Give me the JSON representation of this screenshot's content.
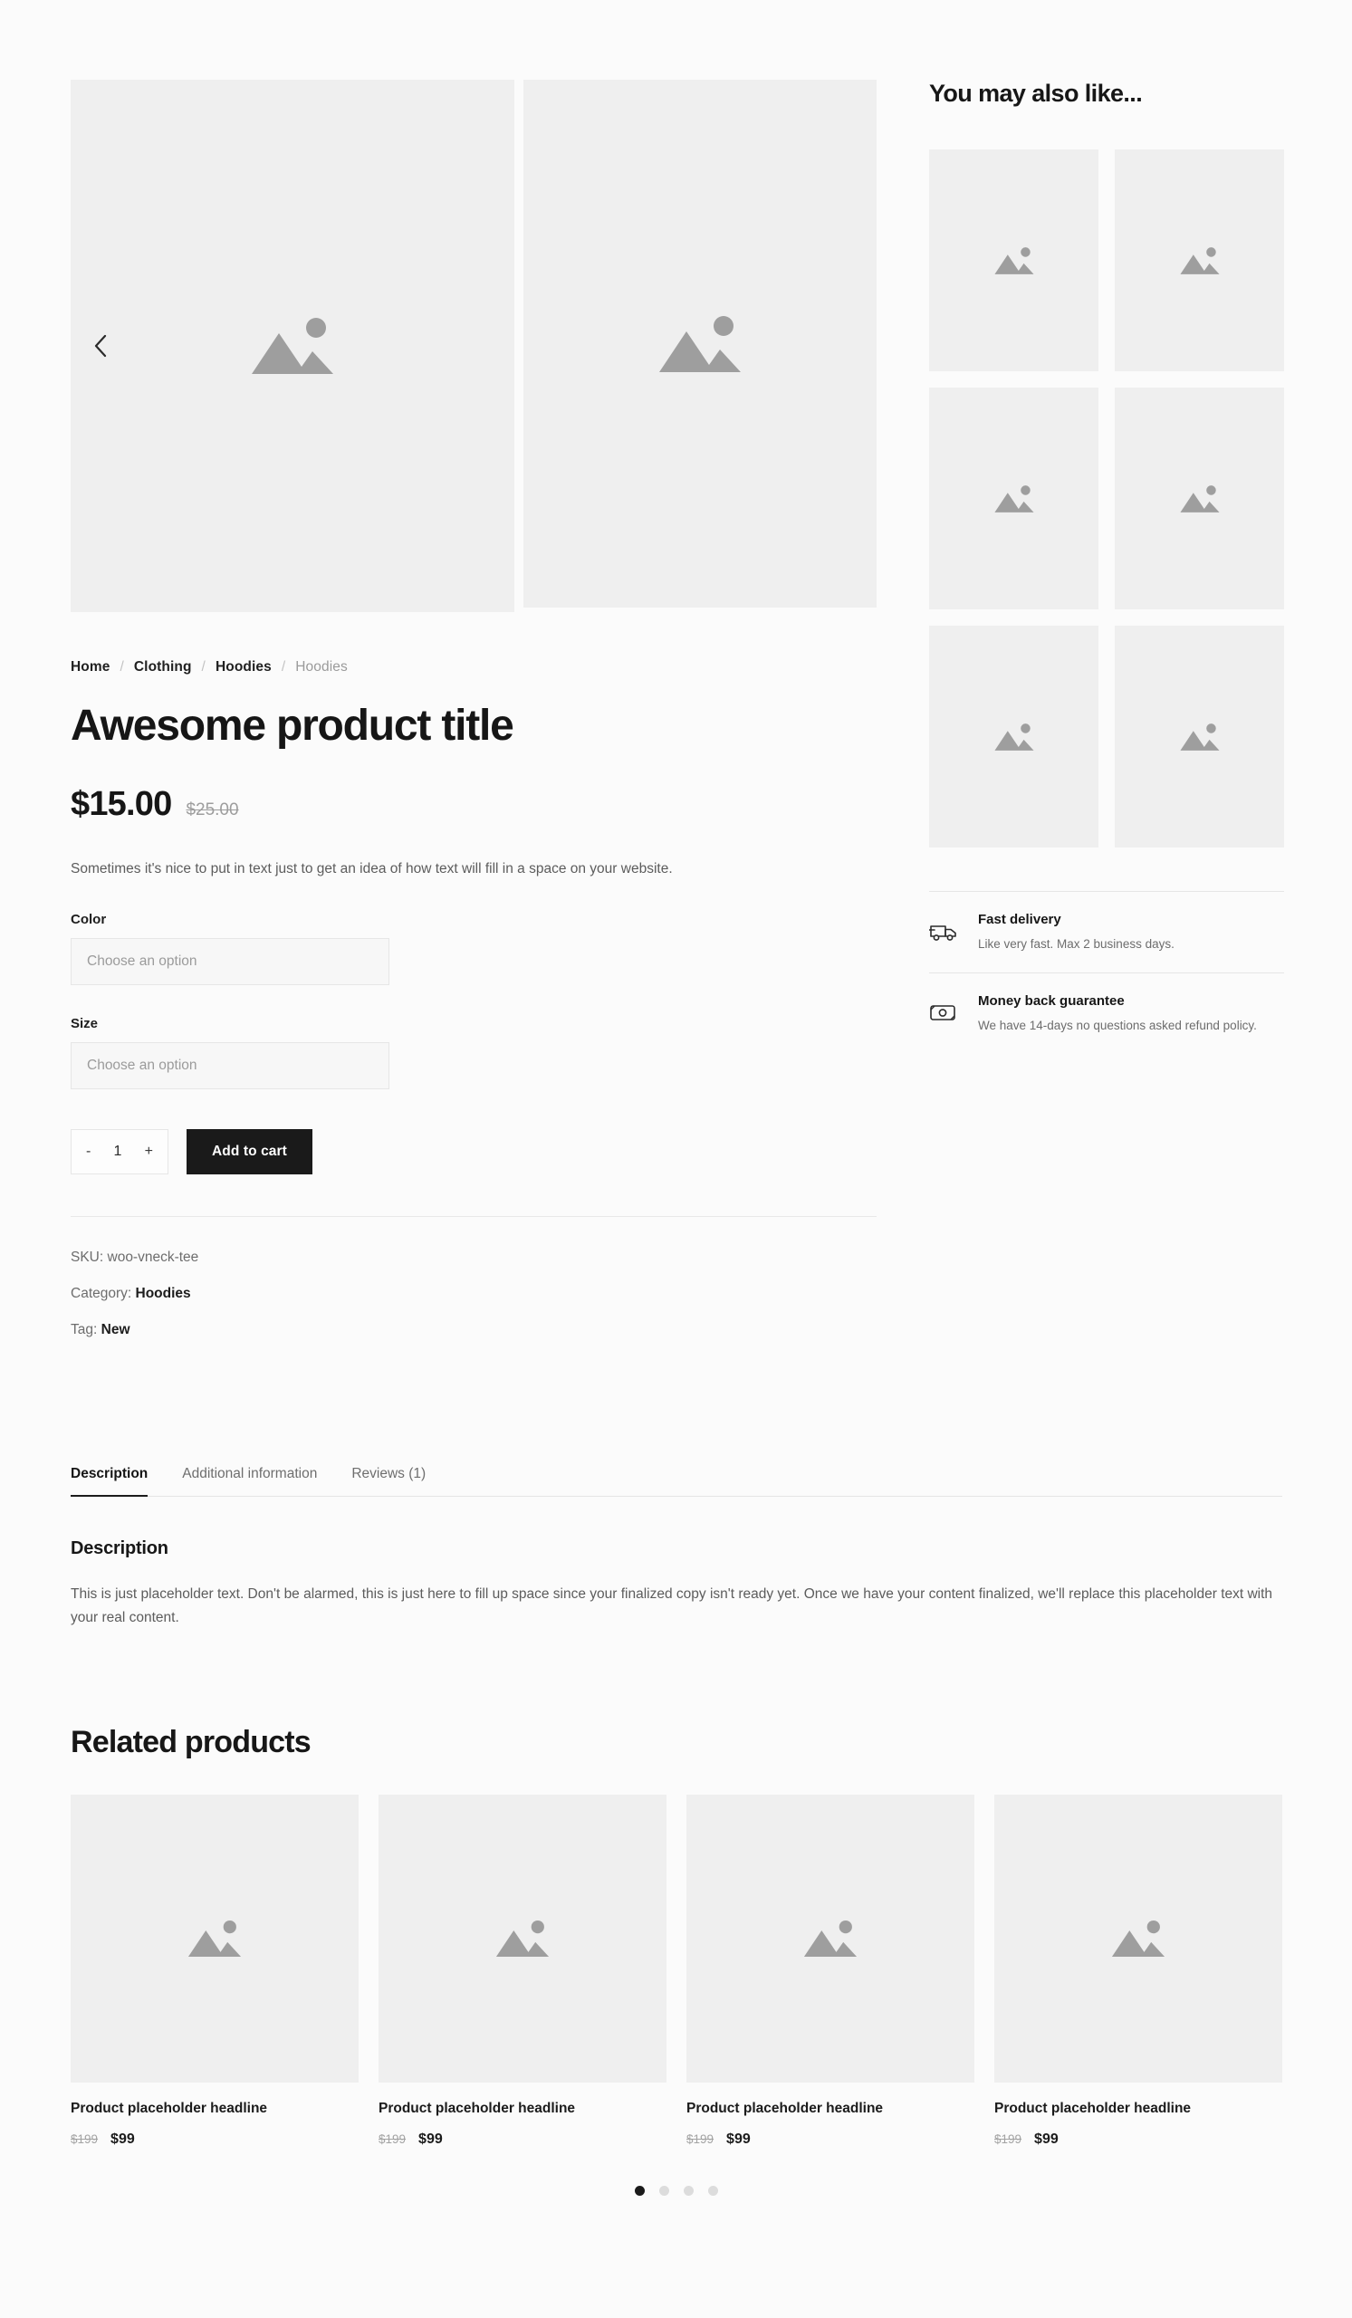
{
  "gallery": {
    "prev_label": "‹",
    "image_alt": "image-placeholder"
  },
  "breadcrumb": {
    "items": [
      {
        "label": "Home",
        "current": false
      },
      {
        "label": "Clothing",
        "current": false
      },
      {
        "label": "Hoodies",
        "current": false
      },
      {
        "label": "Hoodies",
        "current": true
      }
    ],
    "separator": "/"
  },
  "product": {
    "title": "Awesome product title",
    "price_current": "$15.00",
    "price_original": "$25.00",
    "short_description": "Sometimes it's nice to put in text just to get an idea of how text will fill in a space on your website.",
    "options": [
      {
        "label": "Color",
        "placeholder": "Choose an option",
        "value": ""
      },
      {
        "label": "Size",
        "placeholder": "Choose an option",
        "value": ""
      }
    ],
    "quantity": {
      "decrement": "-",
      "value": "1",
      "increment": "+"
    },
    "add_to_cart_label": "Add to cart",
    "meta": {
      "sku_label": "SKU:",
      "sku_value": "woo-vneck-tee",
      "category_label": "Category:",
      "category_value": "Hoodies",
      "tag_label": "Tag:",
      "tag_value": "New"
    }
  },
  "tabs": {
    "items": [
      {
        "label": "Description",
        "active": true
      },
      {
        "label": "Additional information",
        "active": false
      },
      {
        "label": "Reviews (1)",
        "active": false
      }
    ],
    "panel": {
      "heading": "Description",
      "body": "This is just placeholder text. Don't be alarmed, this is just here to fill up space since your finalized copy isn't ready yet. Once we have your content finalized, we'll replace this placeholder text with your real content."
    }
  },
  "related": {
    "heading": "Related products",
    "products": [
      {
        "name": "Product placeholder headline",
        "price_original": "$199",
        "price_current": "$99"
      },
      {
        "name": "Product placeholder headline",
        "price_original": "$199",
        "price_current": "$99"
      },
      {
        "name": "Product placeholder headline",
        "price_original": "$199",
        "price_current": "$99"
      },
      {
        "name": "Product placeholder headline",
        "price_original": "$199",
        "price_current": "$99"
      }
    ],
    "carousel_dots": [
      {
        "active": true
      },
      {
        "active": false
      },
      {
        "active": false
      },
      {
        "active": false
      }
    ]
  },
  "sidebar": {
    "heading": "You may also like...",
    "thumbnails": [
      1,
      2,
      3,
      4,
      5,
      6
    ],
    "features": [
      {
        "icon": "truck-icon",
        "title": "Fast delivery",
        "subtitle": "Like very fast. Max 2 business days."
      },
      {
        "icon": "banknote-icon",
        "title": "Money back guarantee",
        "subtitle": "We have 14-days no questions asked refund policy."
      }
    ]
  },
  "colors": {
    "page_bg": "#fbfbfb",
    "placeholder_bg": "#efefef",
    "placeholder_fg": "#9e9e9e",
    "text_primary": "#161616",
    "text_muted": "#6d6d6d",
    "accent_dark": "#1a1a1a"
  }
}
